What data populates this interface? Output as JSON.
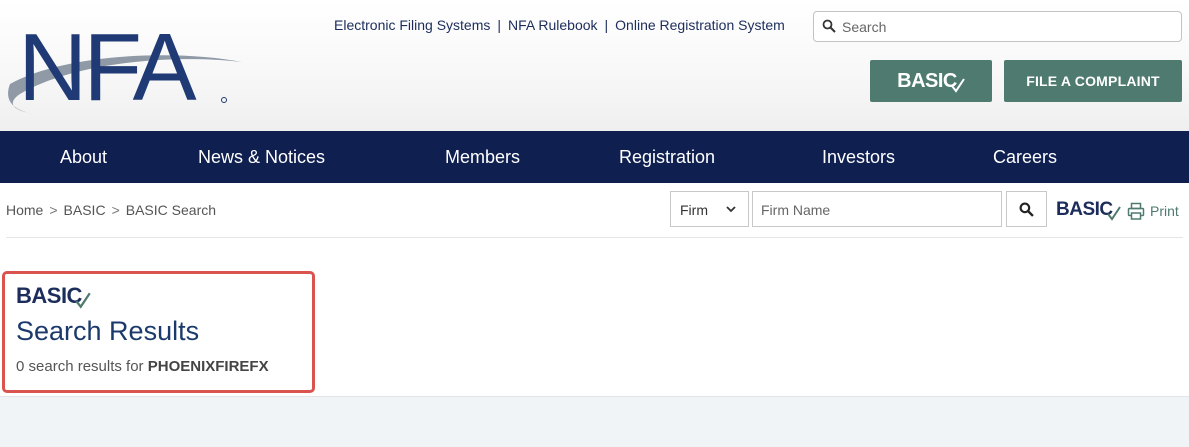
{
  "header": {
    "logo_text": "NFA",
    "links": [
      "Electronic Filing Systems",
      "NFA Rulebook",
      "Online Registration System"
    ],
    "link_separator": "|",
    "search_placeholder": "Search",
    "basic_button_label": "BASIC",
    "complaint_button_label": "FILE A COMPLAINT",
    "brand_color": "#0f1f4f",
    "button_color": "#4e7a6f"
  },
  "nav": {
    "items": [
      "About",
      "News & Notices",
      "Members",
      "Registration",
      "Investors",
      "Careers"
    ]
  },
  "breadcrumb": {
    "items": [
      "Home",
      "BASIC",
      "BASIC Search"
    ],
    "separator": ">"
  },
  "firm_search": {
    "type_value": "Firm",
    "name_placeholder": "Firm Name",
    "basic_label": "BASIC",
    "print_label": "Print"
  },
  "results": {
    "basic_label": "BASIC",
    "title": "Search Results",
    "summary_prefix": "0 search results for",
    "query": "PHOENIXFIREFX",
    "highlight_color": "#d9534f"
  }
}
